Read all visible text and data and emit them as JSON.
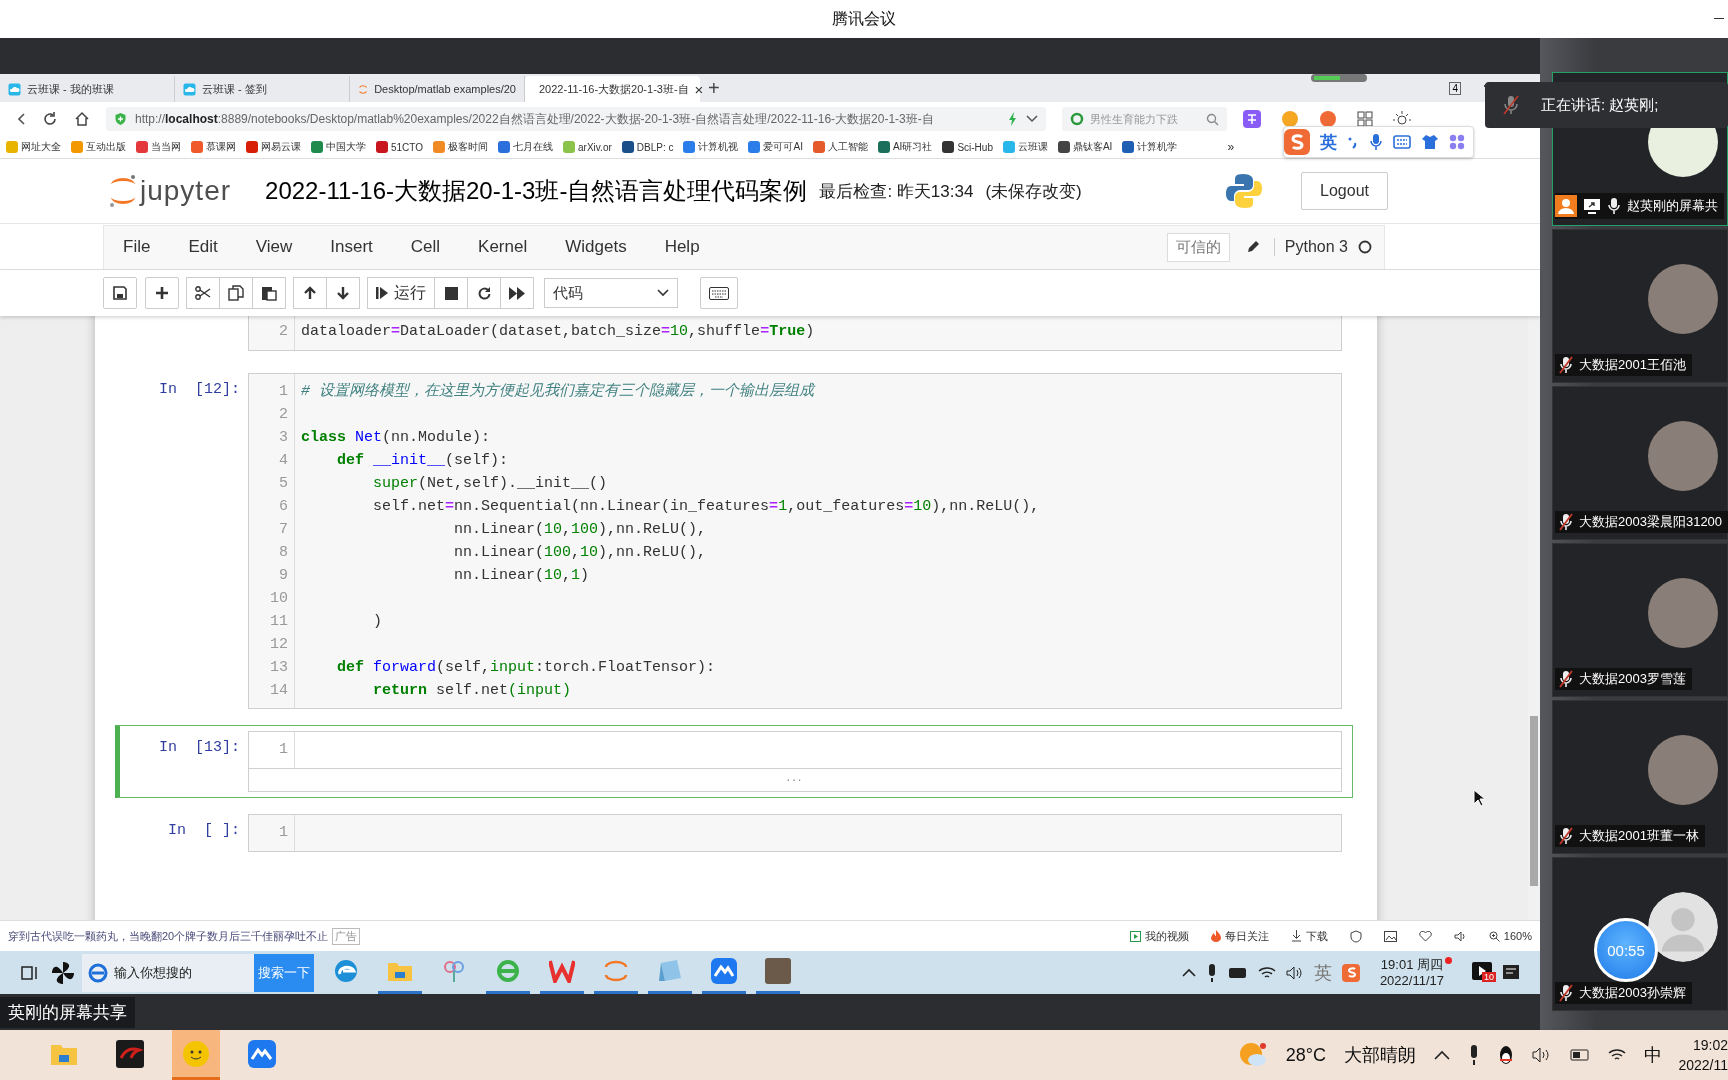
{
  "app_title": "腾讯会议",
  "browser": {
    "tabs": [
      {
        "label": "云班课 - 我的班课",
        "selected": false
      },
      {
        "label": "云班课 - 签到",
        "selected": false
      },
      {
        "label": "Desktop/matlab examples/20",
        "selected": false
      },
      {
        "label": "2022-11-16-大数据20-1-3班-自",
        "selected": true
      }
    ],
    "close_tab": "×",
    "new_tab": "+",
    "window_count": "4",
    "address": "http://**localhost**:8889/notebooks/Desktop/matlab%20examples/2022自然语言处理/2022-大数据-20-1-3班-自然语言处理/2022-11-16-大数据20-1-3班-自",
    "search_placeholder": "男性生育能力下跌",
    "bookmarks": [
      {
        "label": "网址大全",
        "color": "#e8b400"
      },
      {
        "label": "互动出版",
        "color": "#f39800"
      },
      {
        "label": "当当网",
        "color": "#e4393c"
      },
      {
        "label": "慕课网",
        "color": "#f0592a"
      },
      {
        "label": "网易云课",
        "color": "#d81e06"
      },
      {
        "label": "中国大学",
        "color": "#1f8a4c"
      },
      {
        "label": "51CTO",
        "color": "#c9151e"
      },
      {
        "label": "极客时间",
        "color": "#f08a24"
      },
      {
        "label": "七月在线",
        "color": "#2a6fdb"
      },
      {
        "label": "arXiv.or",
        "color": "#8bc34a"
      },
      {
        "label": "DBLP: c",
        "color": "#1a4f8a"
      },
      {
        "label": "计算机视",
        "color": "#2b7de9"
      },
      {
        "label": "爱可可AI",
        "color": "#2b7de9"
      },
      {
        "label": "人工智能",
        "color": "#e55a2b"
      },
      {
        "label": "AI研习社",
        "color": "#1c6f5a"
      },
      {
        "label": "Sci-Hub",
        "color": "#333333"
      },
      {
        "label": "云班课",
        "color": "#29b6e8"
      },
      {
        "label": "鼎钛客AI",
        "color": "#444444"
      },
      {
        "label": "计算机学",
        "color": "#1e5fb4"
      }
    ],
    "bookmarks_more": "»"
  },
  "ime": {
    "label": "英"
  },
  "jupyter": {
    "logo": "jupyter",
    "title": "2022-11-16-大数据20-1-3班-自然语言处理代码案例",
    "checkpoint": "最后检查: 昨天13:34",
    "unsaved": "(未保存改变)",
    "logout": "Logout",
    "menu": [
      "File",
      "Edit",
      "View",
      "Insert",
      "Cell",
      "Kernel",
      "Widgets",
      "Help"
    ],
    "trusted": "可信的",
    "kernel": "Python 3",
    "kernel_busy": false,
    "run_label": "运行",
    "cell_type": "代码"
  },
  "cells": [
    {
      "selected": false,
      "lines": [
        {
          "number": "2",
          "tokens": [
            {
              "kind": "text",
              "text": "dataloader"
            },
            {
              "kind": "op",
              "text": "="
            },
            {
              "kind": "text",
              "text": "DataLoader(dataset,batch_size"
            },
            {
              "kind": "op",
              "text": "="
            },
            {
              "kind": "number",
              "text": "10"
            },
            {
              "kind": "text",
              "text": ",shuffle"
            },
            {
              "kind": "op",
              "text": "="
            },
            {
              "kind": "keyword",
              "text": "True"
            },
            {
              "kind": "text",
              "text": ")"
            }
          ]
        }
      ]
    },
    {
      "prompt": "In  [12]:",
      "selected": false,
      "lines": [
        {
          "number": "1",
          "tokens": [
            {
              "kind": "comment",
              "text": "# 设置网络模型，在这里为方便起见我们嘉定有三个隐藏层，一个输出层组成"
            }
          ]
        },
        {
          "number": "2"
        },
        {
          "number": "3",
          "tokens": [
            {
              "kind": "keyword",
              "text": "class"
            },
            {
              "kind": "name",
              "text": " Net"
            },
            {
              "kind": "text",
              "text": "(nn.Module):"
            }
          ]
        },
        {
          "number": "4",
          "tokens": [
            {
              "kind": "keyword",
              "text": "    def"
            },
            {
              "kind": "name",
              "text": " __init__"
            },
            {
              "kind": "text",
              "text": "(self):"
            }
          ]
        },
        {
          "number": "5",
          "tokens": [
            {
              "kind": "builtin",
              "text": "        super"
            },
            {
              "kind": "text",
              "text": "(Net,self).__init__()"
            }
          ]
        },
        {
          "number": "6",
          "tokens": [
            {
              "kind": "text",
              "text": "        self.net"
            },
            {
              "kind": "op",
              "text": "="
            },
            {
              "kind": "text",
              "text": "nn.Sequential(nn.Linear(in_features"
            },
            {
              "kind": "op",
              "text": "="
            },
            {
              "kind": "number",
              "text": "1"
            },
            {
              "kind": "text",
              "text": ",out_features"
            },
            {
              "kind": "op",
              "text": "="
            },
            {
              "kind": "number",
              "text": "10"
            },
            {
              "kind": "text",
              "text": "),nn.ReLU(),"
            }
          ]
        },
        {
          "number": "7",
          "tokens": [
            {
              "kind": "text",
              "text": "                 nn.Linear("
            },
            {
              "kind": "number",
              "text": "10"
            },
            {
              "kind": "text",
              "text": ","
            },
            {
              "kind": "number",
              "text": "100"
            },
            {
              "kind": "text",
              "text": "),nn.ReLU(),"
            }
          ]
        },
        {
          "number": "8",
          "tokens": [
            {
              "kind": "text",
              "text": "                 nn.Linear("
            },
            {
              "kind": "number",
              "text": "100"
            },
            {
              "kind": "text",
              "text": ","
            },
            {
              "kind": "number",
              "text": "10"
            },
            {
              "kind": "text",
              "text": "),nn.ReLU(),"
            }
          ]
        },
        {
          "number": "9",
          "tokens": [
            {
              "kind": "text",
              "text": "                 nn.Linear("
            },
            {
              "kind": "number",
              "text": "10"
            },
            {
              "kind": "text",
              "text": ","
            },
            {
              "kind": "number",
              "text": "1"
            },
            {
              "kind": "text",
              "text": ")"
            }
          ]
        },
        {
          "number": "10"
        },
        {
          "number": "11",
          "tokens": [
            {
              "kind": "text",
              "text": "        )"
            }
          ]
        },
        {
          "number": "12"
        },
        {
          "number": "13",
          "tokens": [
            {
              "kind": "keyword",
              "text": "    def"
            },
            {
              "kind": "name",
              "text": " forward"
            },
            {
              "kind": "text",
              "text": "(self,"
            },
            {
              "kind": "builtin",
              "text": "input"
            },
            {
              "kind": "text",
              "text": ":torch.FloatTensor):"
            }
          ]
        },
        {
          "number": "14",
          "tokens": [
            {
              "kind": "keyword",
              "text": "        return"
            },
            {
              "kind": "text",
              "text": " self.net"
            },
            {
              "kind": "builtin",
              "text": "(input)"
            }
          ]
        }
      ]
    },
    {
      "prompt": "In  [13]:",
      "selected": true,
      "lines": [
        {
          "number": "1"
        }
      ],
      "output": "..."
    },
    {
      "prompt": "In  [ ]:",
      "selected": false,
      "lines": [
        {
          "number": "1"
        }
      ]
    }
  ],
  "status_bar": {
    "news": "穿到古代误吃一颗药丸，当晚翻20个牌子数月后三千佳丽孕吐不止",
    "ad": "广告",
    "items": [
      {
        "label": "我的视频"
      },
      {
        "label": "每日关注"
      },
      {
        "label": "下载"
      }
    ],
    "zoom": "160%"
  },
  "inner_taskbar": {
    "search_placeholder": "输入你想搜的",
    "search_button": "搜索一下",
    "apps": [
      {
        "running": false
      },
      {
        "running": true
      },
      {
        "running": false
      },
      {
        "running": true
      },
      {
        "running": true
      },
      {
        "running": true
      },
      {
        "running": true
      },
      {
        "running": true
      },
      {
        "running": true
      }
    ],
    "ime": "英",
    "time": "19:01 周四",
    "date": "2022/11/17",
    "badge": "10"
  },
  "share_label": "英刚的屏幕共享",
  "speaking": "正在讲话: 赵英刚;",
  "participants": [
    {
      "name": "赵英刚的屏幕共",
      "kind": "sharing",
      "muted": false,
      "active": true
    },
    {
      "name": "大数据2001王佰池",
      "kind": "photo",
      "muted": true,
      "active": false
    },
    {
      "name": "大数据2003梁晨阳31200",
      "kind": "photo",
      "muted": true,
      "active": false
    },
    {
      "name": "大数据2003罗雪莲",
      "kind": "photo",
      "muted": true,
      "active": false
    },
    {
      "name": "大数据2001班董一林",
      "kind": "photo",
      "muted": true,
      "active": false
    },
    {
      "name": "大数据2003孙崇辉",
      "kind": "default",
      "muted": true,
      "active": false
    }
  ],
  "timer": "00:55",
  "host_taskbar": {
    "apps": [
      {
        "running": false
      },
      {
        "running": false
      },
      {
        "running": true
      },
      {
        "running": false
      }
    ],
    "temperature": "28°C",
    "weather": "大部晴朗",
    "ime": "中",
    "time": "19:02",
    "date": "2022/11"
  }
}
